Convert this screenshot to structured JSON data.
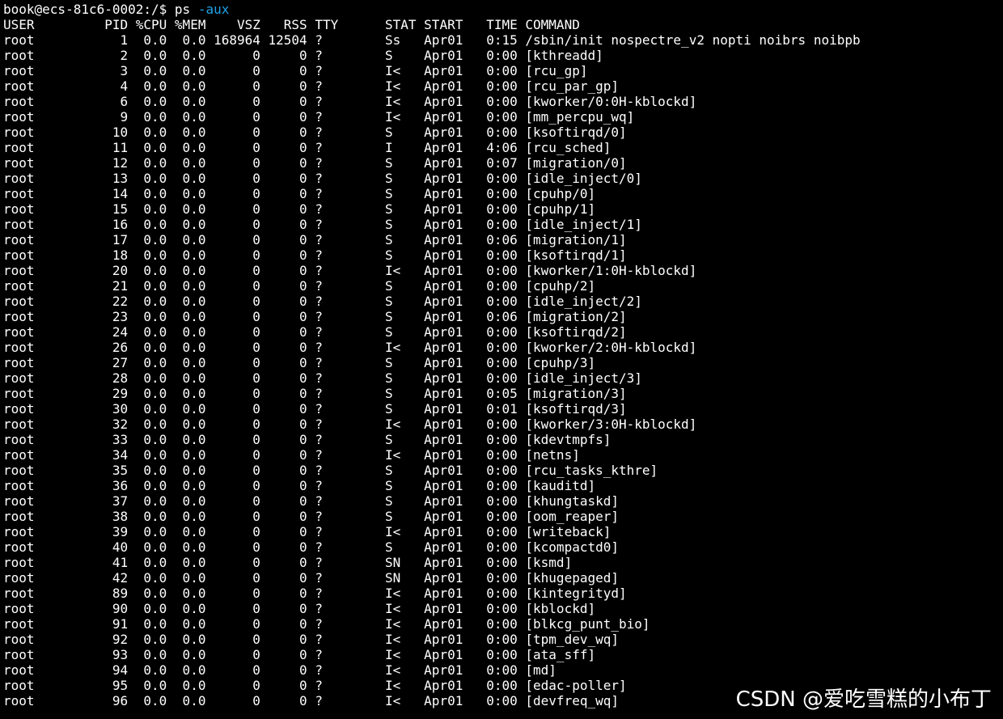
{
  "terminal": {
    "prompt": "book@ecs-81c6-0002:/$ ",
    "command": "ps",
    "command_args": " -aux",
    "header": "USER         PID %CPU %MEM    VSZ   RSS TTY      STAT START   TIME COMMAND",
    "lines": [
      "root           1  0.0  0.0 168964 12504 ?        Ss   Apr01   0:15 /sbin/init nospectre_v2 nopti noibrs noibpb",
      "root           2  0.0  0.0      0     0 ?        S    Apr01   0:00 [kthreadd]",
      "root           3  0.0  0.0      0     0 ?        I<   Apr01   0:00 [rcu_gp]",
      "root           4  0.0  0.0      0     0 ?        I<   Apr01   0:00 [rcu_par_gp]",
      "root           6  0.0  0.0      0     0 ?        I<   Apr01   0:00 [kworker/0:0H-kblockd]",
      "root           9  0.0  0.0      0     0 ?        I<   Apr01   0:00 [mm_percpu_wq]",
      "root          10  0.0  0.0      0     0 ?        S    Apr01   0:00 [ksoftirqd/0]",
      "root          11  0.0  0.0      0     0 ?        I    Apr01   4:06 [rcu_sched]",
      "root          12  0.0  0.0      0     0 ?        S    Apr01   0:07 [migration/0]",
      "root          13  0.0  0.0      0     0 ?        S    Apr01   0:00 [idle_inject/0]",
      "root          14  0.0  0.0      0     0 ?        S    Apr01   0:00 [cpuhp/0]",
      "root          15  0.0  0.0      0     0 ?        S    Apr01   0:00 [cpuhp/1]",
      "root          16  0.0  0.0      0     0 ?        S    Apr01   0:00 [idle_inject/1]",
      "root          17  0.0  0.0      0     0 ?        S    Apr01   0:06 [migration/1]",
      "root          18  0.0  0.0      0     0 ?        S    Apr01   0:00 [ksoftirqd/1]",
      "root          20  0.0  0.0      0     0 ?        I<   Apr01   0:00 [kworker/1:0H-kblockd]",
      "root          21  0.0  0.0      0     0 ?        S    Apr01   0:00 [cpuhp/2]",
      "root          22  0.0  0.0      0     0 ?        S    Apr01   0:00 [idle_inject/2]",
      "root          23  0.0  0.0      0     0 ?        S    Apr01   0:06 [migration/2]",
      "root          24  0.0  0.0      0     0 ?        S    Apr01   0:00 [ksoftirqd/2]",
      "root          26  0.0  0.0      0     0 ?        I<   Apr01   0:00 [kworker/2:0H-kblockd]",
      "root          27  0.0  0.0      0     0 ?        S    Apr01   0:00 [cpuhp/3]",
      "root          28  0.0  0.0      0     0 ?        S    Apr01   0:00 [idle_inject/3]",
      "root          29  0.0  0.0      0     0 ?        S    Apr01   0:05 [migration/3]",
      "root          30  0.0  0.0      0     0 ?        S    Apr01   0:01 [ksoftirqd/3]",
      "root          32  0.0  0.0      0     0 ?        I<   Apr01   0:00 [kworker/3:0H-kblockd]",
      "root          33  0.0  0.0      0     0 ?        S    Apr01   0:00 [kdevtmpfs]",
      "root          34  0.0  0.0      0     0 ?        I<   Apr01   0:00 [netns]",
      "root          35  0.0  0.0      0     0 ?        S    Apr01   0:00 [rcu_tasks_kthre]",
      "root          36  0.0  0.0      0     0 ?        S    Apr01   0:00 [kauditd]",
      "root          37  0.0  0.0      0     0 ?        S    Apr01   0:00 [khungtaskd]",
      "root          38  0.0  0.0      0     0 ?        S    Apr01   0:00 [oom_reaper]",
      "root          39  0.0  0.0      0     0 ?        I<   Apr01   0:00 [writeback]",
      "root          40  0.0  0.0      0     0 ?        S    Apr01   0:00 [kcompactd0]",
      "root          41  0.0  0.0      0     0 ?        SN   Apr01   0:00 [ksmd]",
      "root          42  0.0  0.0      0     0 ?        SN   Apr01   0:00 [khugepaged]",
      "root          89  0.0  0.0      0     0 ?        I<   Apr01   0:00 [kintegrityd]",
      "root          90  0.0  0.0      0     0 ?        I<   Apr01   0:00 [kblockd]",
      "root          91  0.0  0.0      0     0 ?        I<   Apr01   0:00 [blkcg_punt_bio]",
      "root          92  0.0  0.0      0     0 ?        I<   Apr01   0:00 [tpm_dev_wq]",
      "root          93  0.0  0.0      0     0 ?        I<   Apr01   0:00 [ata_sff]",
      "root          94  0.0  0.0      0     0 ?        I<   Apr01   0:00 [md]",
      "root          95  0.0  0.0      0     0 ?        I<   Apr01   0:00 [edac-poller]",
      "root          96  0.0  0.0      0     0 ?        I<   Apr01   0:00 [devfreq_wq]"
    ]
  },
  "watermark": "CSDN @爱吃雪糕的小布丁",
  "colors": {
    "background": "#000000",
    "text": "#ffffff",
    "command_arg": "#1fa3e8"
  }
}
